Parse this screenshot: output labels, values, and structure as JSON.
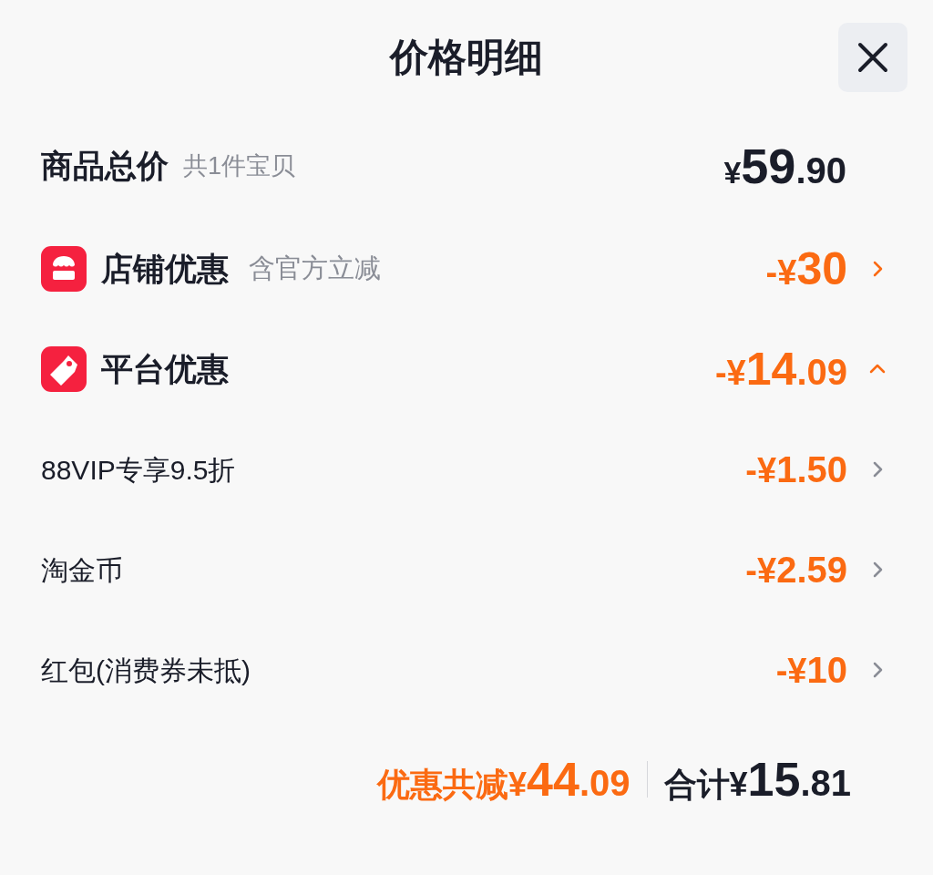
{
  "title": "价格明细",
  "total": {
    "label": "商品总价",
    "note": "共1件宝贝",
    "amount": {
      "sign": "¥",
      "whole": "59",
      "fraction": ".90"
    }
  },
  "rows": [
    {
      "kind": "section",
      "label": "店铺优惠",
      "note": "含官方立减",
      "amount": {
        "sign": "-¥",
        "whole": "30"
      },
      "expanded": false
    },
    {
      "kind": "section",
      "label": "平台优惠",
      "amount": {
        "sign": "-¥",
        "whole": "14",
        "fraction": ".09"
      },
      "expanded": true
    },
    {
      "kind": "item",
      "label": "88VIP专享9.5折",
      "amount": {
        "sign": "-¥",
        "whole": "1.50"
      },
      "expanded": false
    },
    {
      "kind": "item",
      "label": "淘金币",
      "amount": {
        "sign": "-¥",
        "whole": "2.59"
      },
      "expanded": false
    },
    {
      "kind": "item",
      "label": "红包(消费券未抵)",
      "amount": {
        "sign": "-¥",
        "whole": "10"
      },
      "expanded": false
    }
  ],
  "footer": {
    "discount": {
      "label": "优惠共减",
      "sign": "¥",
      "whole": "44",
      "fraction": ".09"
    },
    "sum": {
      "label": "合计",
      "sign": "¥",
      "whole": "15",
      "fraction": ".81"
    }
  }
}
